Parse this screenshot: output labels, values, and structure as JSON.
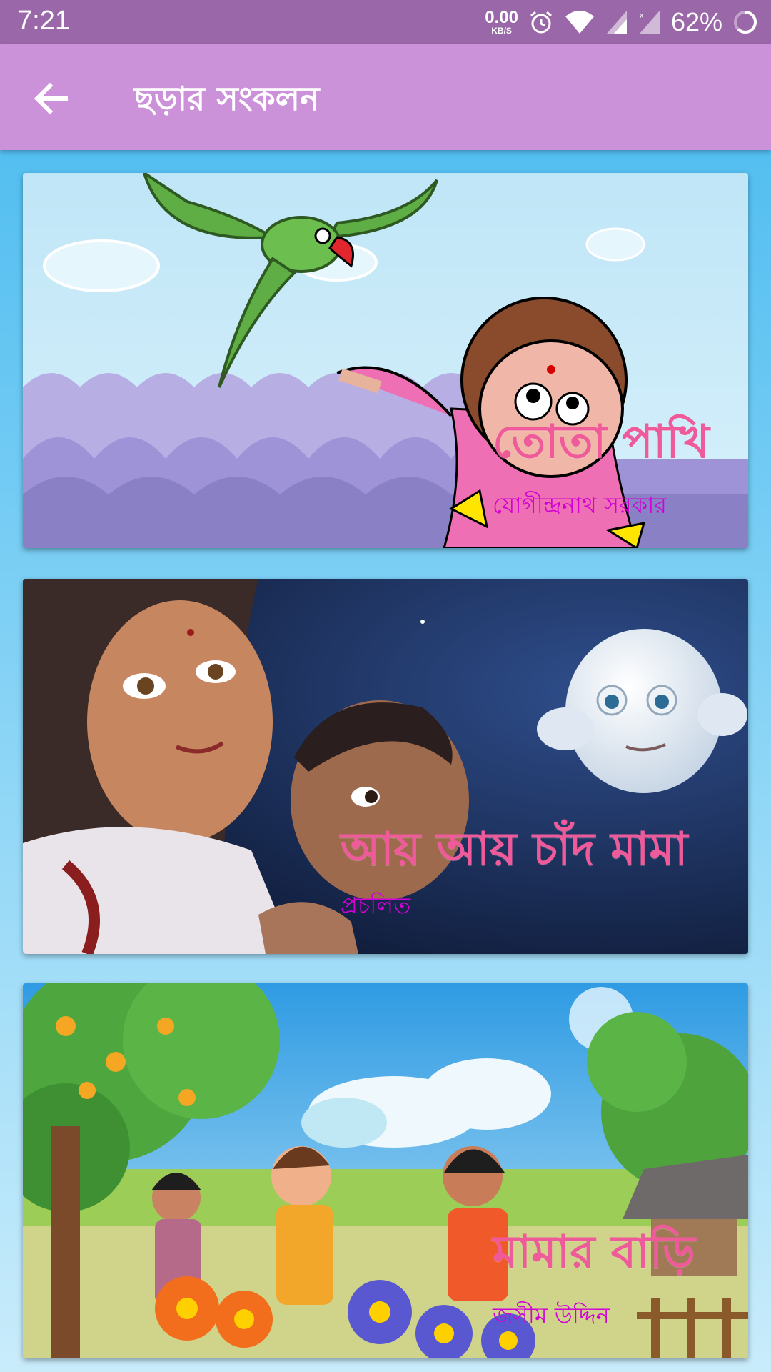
{
  "status_bar": {
    "time": "7:21",
    "net_speed": "0.00",
    "net_unit": "KB/S",
    "battery": "62%",
    "icons": [
      "alarm-icon",
      "wifi-icon",
      "signal-icon",
      "signal-icon",
      "battery-icon"
    ]
  },
  "app_bar": {
    "title": "ছড়ার সংকলন",
    "back_icon": "arrow-left-icon"
  },
  "rhymes": [
    {
      "title": "তোতা পাখি",
      "author": "যোগীন্দ্রনাথ সরকার"
    },
    {
      "title": "আয় আয় চাঁদ মামা",
      "author": "প্রচলিত"
    },
    {
      "title": "মামার বাড়ি",
      "author": "জসীম উদ্দিন"
    }
  ],
  "colors": {
    "status_bar": "#9a67a8",
    "app_bar": "#cc92d9",
    "title_text": "#ef5a9a",
    "author_text": "#d200d6",
    "background": "#45b9ef"
  }
}
